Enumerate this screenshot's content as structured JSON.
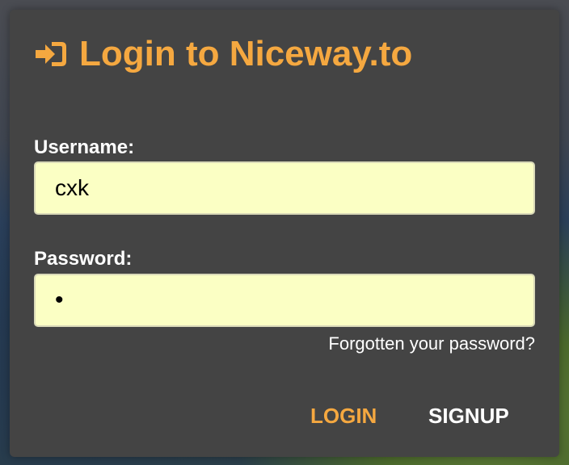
{
  "dialog": {
    "title": "Login to Niceway.to",
    "title_icon": "sign-in-icon",
    "accent_color": "#f5a840",
    "background_color": "#444444"
  },
  "form": {
    "username_label": "Username:",
    "username_value": "cxk",
    "password_label": "Password:",
    "password_value": "•",
    "input_background": "#fbffc4",
    "forgot_link": "Forgotten your password?"
  },
  "actions": {
    "login_label": "LOGIN",
    "signup_label": "SIGNUP"
  }
}
